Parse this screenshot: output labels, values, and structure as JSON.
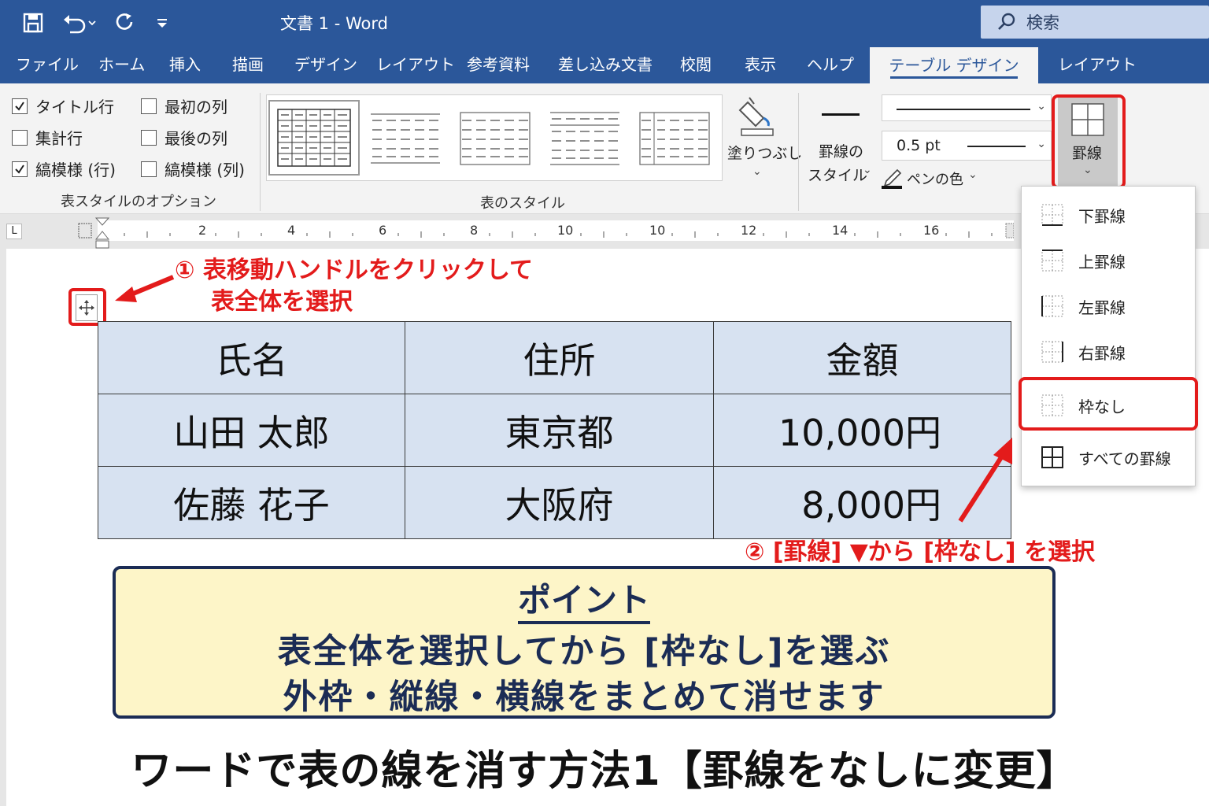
{
  "window": {
    "title": "文書 1  -  Word",
    "search_placeholder": "検索"
  },
  "tabs": [
    "ファイル",
    "ホーム",
    "挿入",
    "描画",
    "デザイン",
    "レイアウト",
    "参考資料",
    "差し込み文書",
    "校閲",
    "表示",
    "ヘルプ",
    "テーブル デザイン",
    "レイアウト"
  ],
  "active_tab": "テーブル デザイン",
  "ribbon": {
    "style_options": {
      "items": [
        {
          "label": "タイトル行",
          "checked": true
        },
        {
          "label": "最初の列",
          "checked": false
        },
        {
          "label": "集計行",
          "checked": false
        },
        {
          "label": "最後の列",
          "checked": false
        },
        {
          "label": "縞模様 (行)",
          "checked": true
        },
        {
          "label": "縞模様 (列)",
          "checked": false
        }
      ],
      "group_label": "表スタイルのオプション"
    },
    "table_styles": {
      "group_label": "表のスタイル"
    },
    "shading": {
      "label": "塗りつぶし"
    },
    "border_style": {
      "label_line1": "罫線の",
      "label_line2": "スタイル"
    },
    "pen_weight": "0.5 pt",
    "pen_color": "ペンの色",
    "borders_button": "罫線"
  },
  "ruler": {
    "ticks": [
      "2",
      "4",
      "6",
      "8",
      "10",
      "10",
      "12",
      "14",
      "16"
    ]
  },
  "document": {
    "table": {
      "headers": [
        "氏名",
        "住所",
        "金額"
      ],
      "rows": [
        [
          "山田 太郎",
          "東京都",
          "10,000円"
        ],
        [
          "佐藤 花子",
          "大阪府",
          "8,000円"
        ]
      ]
    }
  },
  "borders_menu": {
    "items": [
      "下罫線",
      "上罫線",
      "左罫線",
      "右罫線",
      "枠なし",
      "すべての罫線"
    ],
    "highlighted": "枠なし"
  },
  "annotations": {
    "step1_line1": "① 表移動ハンドルをクリックして",
    "step1_line2": "表全体を選択",
    "step2": "② [罫線] ▼から [枠なし] を選択"
  },
  "point": {
    "title": "ポイント",
    "line1": "表全体を選択してから [枠なし]を選ぶ",
    "line2": "外枠・縦線・横線をまとめて消せます"
  },
  "headline": "ワードで表の線を消す方法1【罫線をなしに変更】",
  "colors": {
    "word_blue": "#2b579a",
    "highlight_red": "#e31b1b",
    "table_fill": "#d7e2f1",
    "point_bg": "#fdf5c8",
    "point_text": "#1b2c55"
  }
}
